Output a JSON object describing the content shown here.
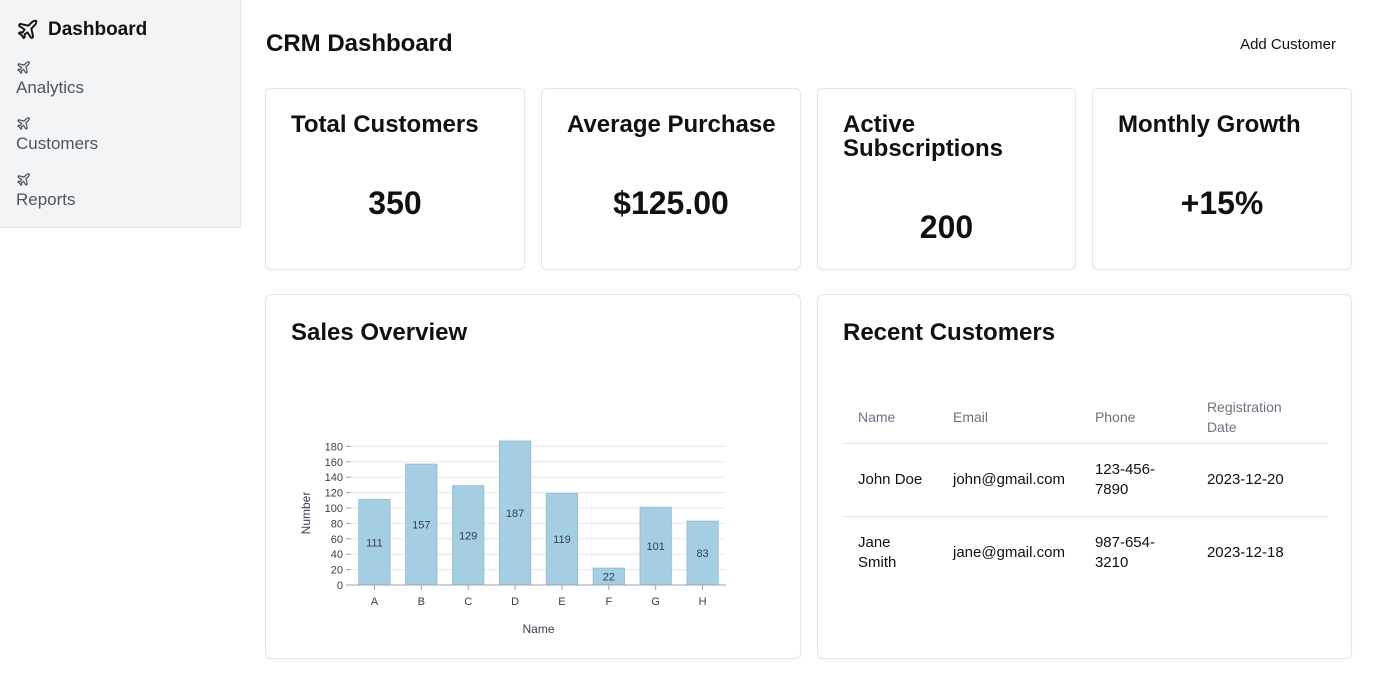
{
  "sidebar": {
    "brand": "Dashboard",
    "items": [
      {
        "label": "Analytics"
      },
      {
        "label": "Customers"
      },
      {
        "label": "Reports"
      }
    ]
  },
  "header": {
    "title": "CRM Dashboard",
    "add_button": "Add Customer"
  },
  "stats": [
    {
      "title": "Total Customers",
      "value": "350"
    },
    {
      "title": "Average Purchase",
      "value": "$125.00"
    },
    {
      "title": "Active Subscriptions",
      "value": "200"
    },
    {
      "title": "Monthly Growth",
      "value": "+15%"
    }
  ],
  "sales": {
    "title": "Sales Overview"
  },
  "chart_data": {
    "type": "bar",
    "categories": [
      "A",
      "B",
      "C",
      "D",
      "E",
      "F",
      "G",
      "H"
    ],
    "values": [
      111,
      157,
      129,
      187,
      119,
      22,
      101,
      83
    ],
    "xlabel": "Name",
    "ylabel": "Number",
    "ylim": [
      0,
      187
    ],
    "yticks": [
      0,
      20,
      40,
      60,
      80,
      100,
      120,
      140,
      160,
      180
    ],
    "grid": true,
    "bar_color": "#a6cee3"
  },
  "recent": {
    "title": "Recent Customers",
    "columns": [
      "Name",
      "Email",
      "Phone",
      "Registration Date"
    ],
    "rows": [
      [
        "John Doe",
        "john@gmail.com",
        "123-456-7890",
        "2023-12-20"
      ],
      [
        "Jane Smith",
        "jane@gmail.com",
        "987-654-3210",
        "2023-12-18"
      ]
    ]
  }
}
